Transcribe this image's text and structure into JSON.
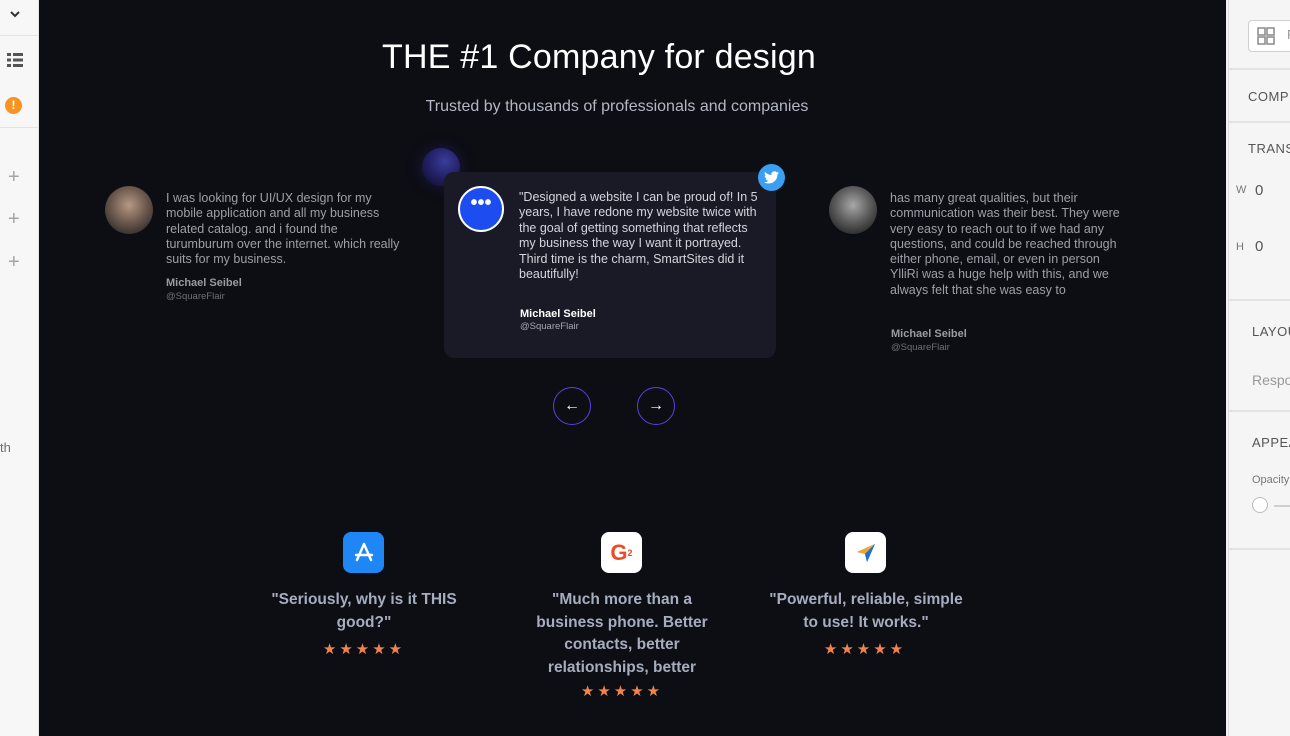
{
  "left_strip": {
    "partial_label": "th"
  },
  "hero": {
    "title": "THE #1 Company for design",
    "subtitle": "Trusted by thousands of professionals and companies"
  },
  "testimonials": {
    "left": {
      "quote": "I was looking for UI/UX design for my mobile application and all my business related catalog. and i found the turumburum over the internet. which really suits for my business.",
      "name": "Michael Seibel",
      "handle": "@SquareFlair"
    },
    "center": {
      "icon_text": "•••",
      "quote": "\"Designed a website I can be proud of! In 5 years, I have redone my website twice with the goal of getting something that reflects my business the way I want it portrayed. Third time is the charm, SmartSites did it beautifully!",
      "name": "Michael Seibel",
      "handle": "@SquareFlair"
    },
    "right": {
      "quote": "has many great qualities, but their communication was their best. They were very easy to reach out to if we had any questions, and could be reached through either phone, email, or even in person\nYlliRi was a huge help with this, and we always felt that she was easy to",
      "name": "Michael Seibel",
      "handle": "@SquareFlair"
    },
    "prev_icon": "←",
    "next_icon": "→"
  },
  "reviews": [
    {
      "logo": "app-store",
      "quote": "\"Seriously, why is it THIS good?\"",
      "stars": "★★★★★"
    },
    {
      "logo": "g2",
      "logo_text": "G",
      "logo_sup": "2",
      "quote": "\"Much more than a business phone. Better contacts, better relationships, better",
      "stars": "★★★★★"
    },
    {
      "logo": "send-arrow",
      "quote": "\"Powerful, reliable, simple to use! It works.\"",
      "stars": "★★★★★"
    }
  ],
  "right_panel": {
    "widget_text": "F",
    "section_comp": "COMP",
    "section_trans": "TRANS",
    "w_label": "W",
    "w_value": "0",
    "h_label": "H",
    "h_value": "0",
    "section_layout": "LAYOU",
    "layout_placeholder": "Respo",
    "section_appear": "APPEA",
    "opacity_label": "Opacity"
  },
  "colors": {
    "canvas_bg": "#0d0d14",
    "accent_purple": "#5b3fe6",
    "star_orange": "#f0844a",
    "twitter_blue": "#3a9ff0",
    "icon_blue": "#1d4df0"
  }
}
